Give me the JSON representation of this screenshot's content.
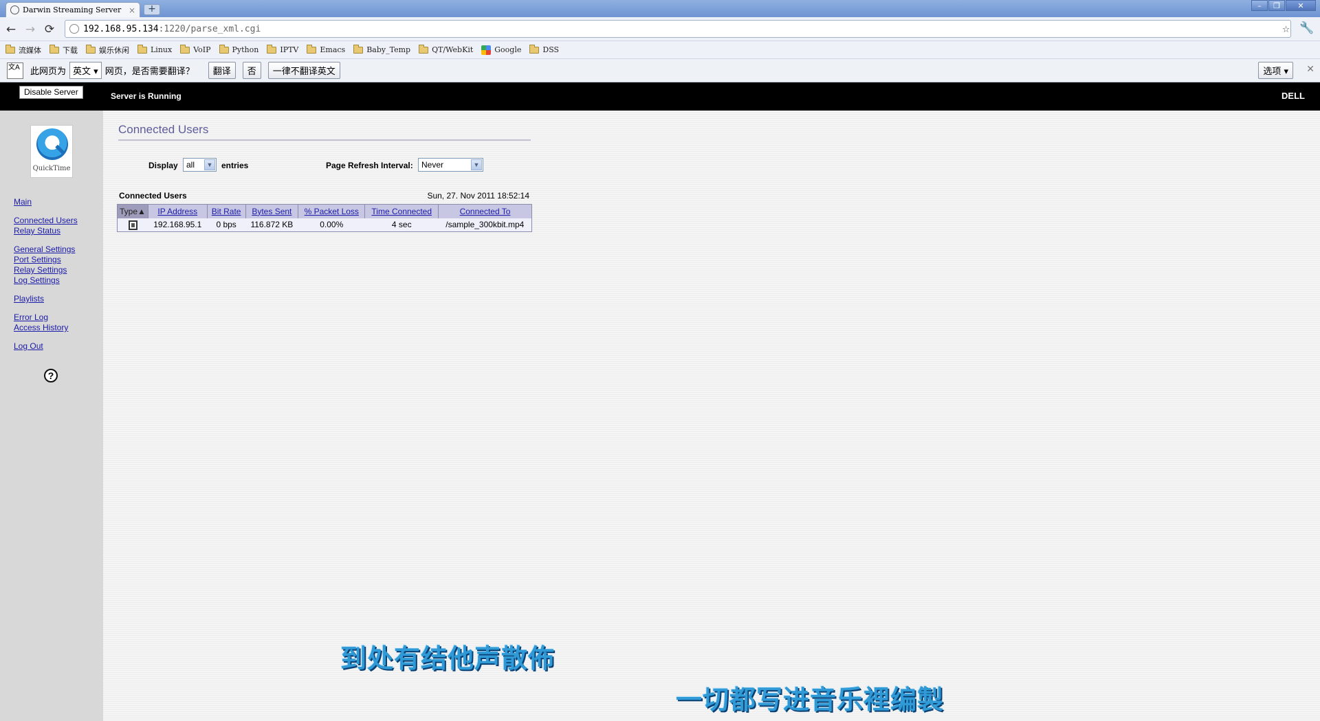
{
  "browser": {
    "tab_title": "Darwin Streaming Server",
    "tab_close": "×",
    "new_tab": "+",
    "address_host": "192.168.95.134",
    "address_path": ":1220/parse_xml.cgi",
    "nav_back": "←",
    "nav_forward": "→",
    "nav_reload": "⟳",
    "star": "☆",
    "wrench": "🔧",
    "window_controls": [
      "–",
      "❐",
      "✕"
    ]
  },
  "bookmarks": [
    {
      "label": "流媒体",
      "icon": "folder-icon"
    },
    {
      "label": "下载",
      "icon": "folder-icon"
    },
    {
      "label": "娱乐休闲",
      "icon": "folder-icon"
    },
    {
      "label": "Linux",
      "icon": "folder-icon"
    },
    {
      "label": "VoIP",
      "icon": "folder-icon"
    },
    {
      "label": "Python",
      "icon": "folder-icon"
    },
    {
      "label": "IPTV",
      "icon": "folder-icon"
    },
    {
      "label": "Emacs",
      "icon": "folder-icon"
    },
    {
      "label": "Baby_Temp",
      "icon": "folder-icon"
    },
    {
      "label": "QT/WebKit",
      "icon": "folder-icon"
    },
    {
      "label": "Google",
      "icon": "google-icon"
    },
    {
      "label": "DSS",
      "icon": "folder-icon"
    }
  ],
  "translate_bar": {
    "icon_text": "文A",
    "prefix": "此网页为",
    "language": "英文",
    "suffix": "网页，是否需要翻译？",
    "translate_button": "翻译",
    "no_button": "否",
    "never_button": "一律不翻译英文",
    "options_button": "选项",
    "close": "✕"
  },
  "header": {
    "disable_button": "Disable Server",
    "status": "Server is Running",
    "brand": "DELL"
  },
  "sidebar": {
    "logo_text": "QuickTime",
    "links": [
      {
        "label": "Main"
      },
      {
        "label": "Connected Users"
      },
      {
        "label": "Relay Status"
      },
      {
        "label": "General Settings"
      },
      {
        "label": "Port Settings"
      },
      {
        "label": "Relay Settings"
      },
      {
        "label": "Log Settings"
      },
      {
        "label": "Playlists"
      },
      {
        "label": "Error Log"
      },
      {
        "label": "Access History"
      },
      {
        "label": "Log Out"
      }
    ],
    "help": "?"
  },
  "main": {
    "title": "Connected Users",
    "display_label": "Display",
    "display_value": "all",
    "entries_label": "entries",
    "refresh_label": "Page Refresh Interval:",
    "refresh_value": "Never",
    "table_caption": "Connected Users",
    "timestamp": "Sun, 27. Nov 2011 18:52:14",
    "columns": [
      "Type▲",
      "IP Address",
      "Bit Rate",
      "Bytes Sent",
      "% Packet Loss",
      "Time Connected",
      "Connected To"
    ],
    "rows": [
      {
        "type_icon": "film-icon",
        "ip": "192.168.95.1",
        "bit_rate": "0 bps",
        "bytes_sent": "116.872 KB",
        "packet_loss": "0.00%",
        "time_connected": "4 sec",
        "connected_to": "/sample_300kbit.mp4"
      }
    ]
  },
  "subtitles": [
    "到处有结他声散佈",
    "一切都写进音乐裡编製"
  ]
}
